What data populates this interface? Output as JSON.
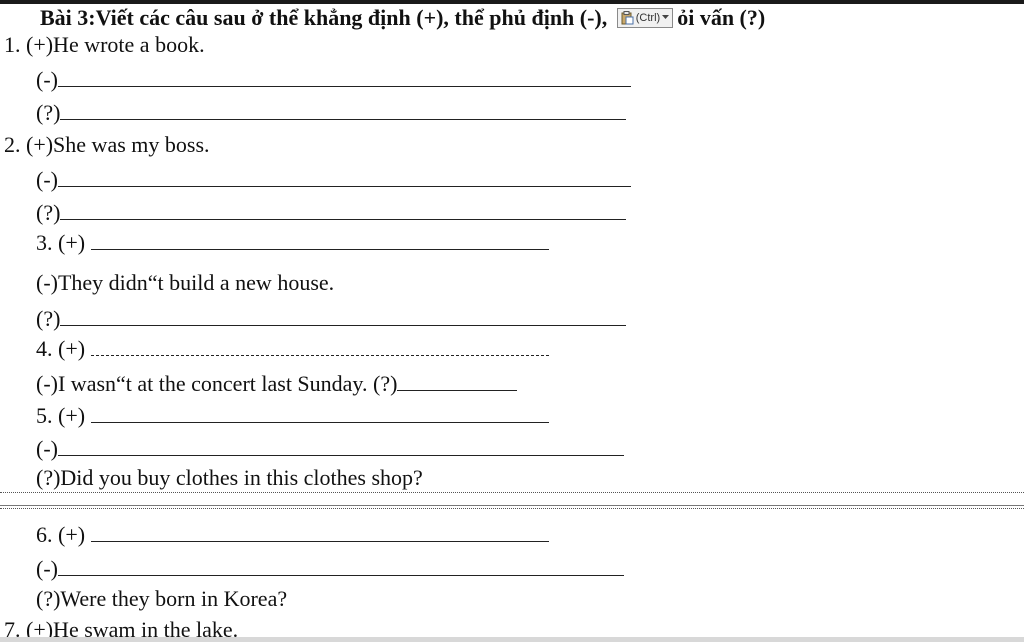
{
  "heading": {
    "text_before": "Bài 3:Viết các câu sau ở thể khẳng định (+), thể phủ định (-), ",
    "text_after": "ỏi vấn (?)",
    "paste_button_label": "(Ctrl)",
    "paste_icon": "clipboard-icon",
    "dropdown_icon": "chevron-down-icon"
  },
  "lines": [
    {
      "id": "l1",
      "text": "1. (+)He wrote a book."
    },
    {
      "id": "l2",
      "text": "(-)"
    },
    {
      "id": "l3",
      "text": "(?)"
    },
    {
      "id": "l4",
      "text": "2. (+)She was my boss."
    },
    {
      "id": "l5",
      "text": "(-)"
    },
    {
      "id": "l6",
      "text": "(?)"
    },
    {
      "id": "l7",
      "text": "3. (+) "
    },
    {
      "id": "l8",
      "text": "(-)They didn“t build a new house."
    },
    {
      "id": "l9",
      "text": "(?)"
    },
    {
      "id": "l10",
      "text": "4. (+) "
    },
    {
      "id": "l11",
      "text": "(-)I wasn“t at the concert last Sunday. (?)"
    },
    {
      "id": "l12",
      "text": "5. (+) "
    },
    {
      "id": "l13",
      "text": "(-)"
    },
    {
      "id": "l14",
      "text": "(?)Did you buy clothes in this clothes shop?"
    },
    {
      "id": "l15",
      "text": "6. (+) "
    },
    {
      "id": "l16",
      "text": "(-)"
    },
    {
      "id": "l17",
      "text": "(?)Were they born in Korea?"
    },
    {
      "id": "l18",
      "text": "7. (+)He swam in the lake."
    }
  ]
}
